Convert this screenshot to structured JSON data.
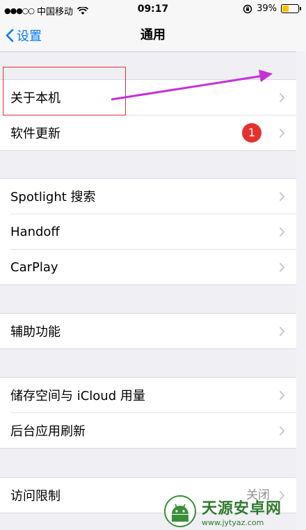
{
  "status_bar": {
    "signal": "●●●○○",
    "carrier": "中国移动",
    "time": "09:17",
    "battery_percent": "39%",
    "battery_level": 0.39
  },
  "nav": {
    "back_label": "设置",
    "title": "通用"
  },
  "groups": [
    {
      "items": [
        {
          "label": "关于本机"
        },
        {
          "label": "软件更新",
          "badge": "1"
        }
      ]
    },
    {
      "items": [
        {
          "label": "Spotlight 搜索"
        },
        {
          "label": "Handoff"
        },
        {
          "label": "CarPlay"
        }
      ]
    },
    {
      "items": [
        {
          "label": "辅助功能"
        }
      ]
    },
    {
      "items": [
        {
          "label": "储存空间与 iCloud 用量"
        },
        {
          "label": "后台应用刷新"
        }
      ]
    },
    {
      "items": [
        {
          "label": "访问限制",
          "detail": "关闭"
        }
      ]
    }
  ],
  "watermark": {
    "name": "天源安卓网",
    "url": "www.jytyaz.com"
  },
  "colors": {
    "accent": "#007aff",
    "badge": "#e5322d",
    "annotation_box": "#e03131",
    "annotation_arrow": "#c62fd8",
    "battery": "#f5c400"
  }
}
